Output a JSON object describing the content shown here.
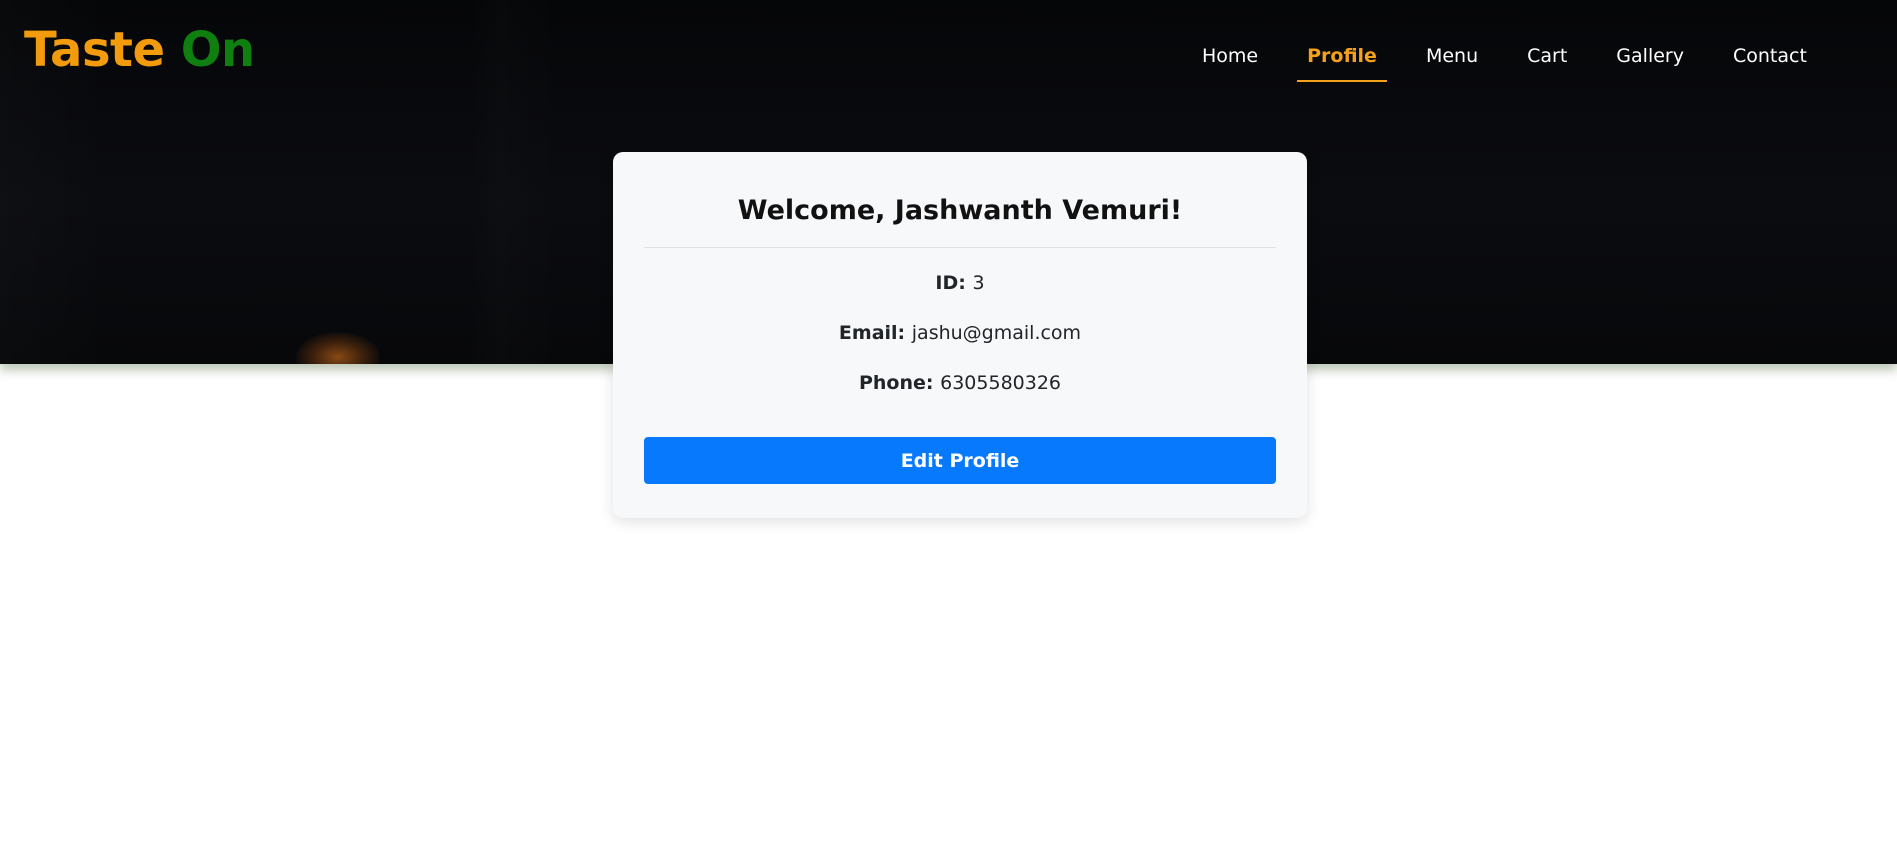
{
  "brand": {
    "first": "Taste",
    "second": "On",
    "first_color": "#f29c0d",
    "second_color": "#0f7f0f"
  },
  "nav": {
    "items": [
      {
        "label": "Home",
        "active": false
      },
      {
        "label": "Profile",
        "active": true
      },
      {
        "label": "Menu",
        "active": false
      },
      {
        "label": "Cart",
        "active": false
      },
      {
        "label": "Gallery",
        "active": false
      },
      {
        "label": "Contact",
        "active": false
      }
    ],
    "active_color": "#f5a21a"
  },
  "profile": {
    "title": "Welcome, Jashwanth Vemuri!",
    "id_label": "ID:",
    "id_value": "3",
    "email_label": "Email:",
    "email_value": "jashu@gmail.com",
    "phone_label": "Phone:",
    "phone_value": "6305580326",
    "edit_button": "Edit Profile",
    "button_color": "#0779fd"
  }
}
